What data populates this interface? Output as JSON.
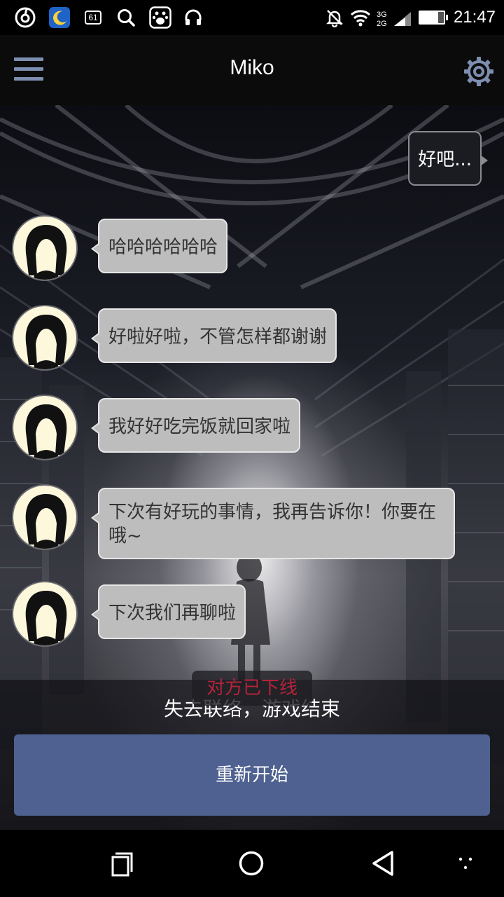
{
  "status_bar": {
    "battery_badge": "61",
    "time": "21:47",
    "left_icons": [
      "netease-music-icon",
      "moon-app-icon",
      "battery-badge-icon",
      "search-icon",
      "baidu-icon",
      "headphones-icon"
    ],
    "right_icons": [
      "mute-bell-icon",
      "wifi-icon",
      "signal-icon",
      "battery-icon"
    ]
  },
  "app_bar": {
    "title": "Miko",
    "accent_color": "#7d8eb0"
  },
  "chat": {
    "outgoing": [
      {
        "text": "好吧..."
      }
    ],
    "incoming": [
      {
        "text": "哈哈哈哈哈哈"
      },
      {
        "text": "好啦好啦，不管怎样都谢谢"
      },
      {
        "text": "我好好吃完饭就回家啦"
      },
      {
        "text": "下次有好玩的事情，我再告诉你！你要在哦~"
      },
      {
        "text": "下次我们再聊啦"
      }
    ]
  },
  "toast": {
    "text": "对方已下线",
    "color": "#b4233a"
  },
  "game_over": {
    "message": "失去联络，游戏结束",
    "restart_label": "重新开始",
    "button_color": "#4e6190"
  },
  "nav_bar": {
    "icons": [
      "recents-icon",
      "home-icon",
      "back-icon",
      "assistant-dots-icon"
    ]
  }
}
